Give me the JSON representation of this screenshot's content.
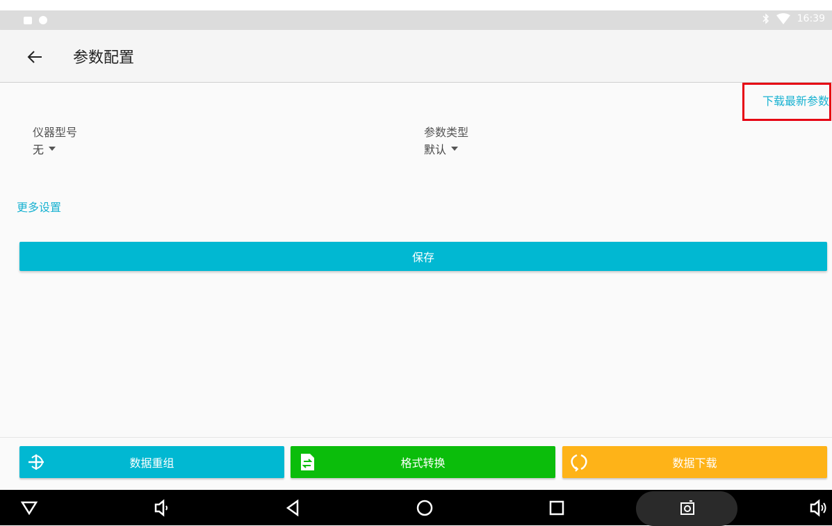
{
  "status_bar": {
    "time": "16:39"
  },
  "app_bar": {
    "title": "参数配置"
  },
  "actions": {
    "download_latest": "下载最新参数"
  },
  "fields": {
    "instrument_model": {
      "label": "仪器型号",
      "value": "无"
    },
    "param_type": {
      "label": "参数类型",
      "value": "默认"
    }
  },
  "more_settings": "更多设置",
  "save_label": "保存",
  "bottom_buttons": [
    {
      "label": "数据重组",
      "color": "#01b8d2",
      "icon": "recombine-icon"
    },
    {
      "label": "格式转换",
      "color": "#0bbd0b",
      "icon": "convert-icon"
    },
    {
      "label": "数据下载",
      "color": "#feb318",
      "icon": "download-sync-icon"
    }
  ],
  "colors": {
    "accent": "#19b2d1",
    "highlight_box": "#e60012"
  }
}
